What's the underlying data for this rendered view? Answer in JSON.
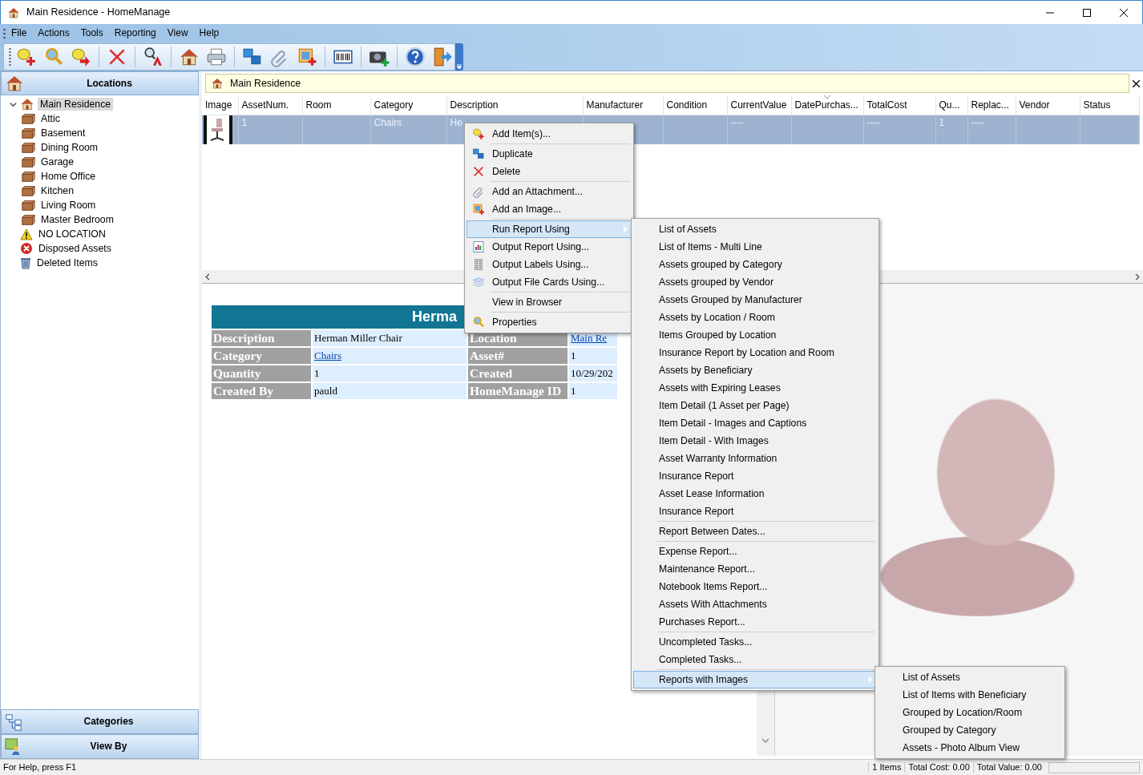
{
  "window": {
    "title": "Main Residence - HomeManage"
  },
  "menu_bar": [
    "File",
    "Actions",
    "Tools",
    "Reporting",
    "View",
    "Help"
  ],
  "sidebar": {
    "title": "Locations",
    "tree": [
      {
        "label": "Main Residence",
        "kind": "residence",
        "selected": true,
        "expanded": true,
        "children": [
          {
            "label": "Attic",
            "kind": "room",
            "selected": false
          },
          {
            "label": "Basement",
            "kind": "room",
            "selected": false
          },
          {
            "label": "Dining Room",
            "kind": "room",
            "selected": false
          },
          {
            "label": "Garage",
            "kind": "room",
            "selected": false
          },
          {
            "label": "Home Office",
            "kind": "room",
            "selected": false
          },
          {
            "label": "Kitchen",
            "kind": "room",
            "selected": false
          },
          {
            "label": "Living Room",
            "kind": "room",
            "selected": false
          },
          {
            "label": "Master Bedroom",
            "kind": "room",
            "selected": false
          }
        ]
      },
      {
        "label": "NO LOCATION",
        "kind": "alert",
        "selected": false
      },
      {
        "label": "Disposed Assets",
        "kind": "disposed",
        "selected": false
      },
      {
        "label": "Deleted Items",
        "kind": "deleted",
        "selected": false
      }
    ],
    "footer_buttons": [
      "Categories",
      "View By"
    ]
  },
  "breadcrumb": "Main Residence",
  "table": {
    "columns": [
      {
        "label": "Image",
        "sorted": false
      },
      {
        "label": "AssetNum.",
        "sorted": false
      },
      {
        "label": "Room",
        "sorted": false
      },
      {
        "label": "Category",
        "sorted": false
      },
      {
        "label": "Description",
        "sorted": false
      },
      {
        "label": "Manufacturer",
        "sorted": false
      },
      {
        "label": "Condition",
        "sorted": false
      },
      {
        "label": "CurrentValue",
        "sorted": false
      },
      {
        "label": "DatePurchas...",
        "sorted": true
      },
      {
        "label": "TotalCost",
        "sorted": false
      },
      {
        "label": "Qu...",
        "sorted": false
      },
      {
        "label": "Replac...",
        "sorted": false
      },
      {
        "label": "Vendor",
        "sorted": false
      },
      {
        "label": "Status",
        "sorted": false
      }
    ],
    "rows": [
      {
        "selected": true,
        "photo": true,
        "cells": [
          null,
          "1",
          null,
          "Chairs",
          "He",
          null,
          null,
          "----",
          null,
          "----",
          "1",
          "----",
          null,
          null
        ]
      }
    ]
  },
  "details": {
    "title": "Herma",
    "fields": [
      {
        "label": "Description",
        "value": "Herman Miller Chair",
        "link": false
      },
      {
        "label": "Location",
        "value": "Main Re",
        "link": true
      },
      {
        "label": "Category",
        "value": "Chairs",
        "link": true
      },
      {
        "label": "Asset#",
        "value": "1",
        "link": false
      },
      {
        "label": "Quantity",
        "value": "1",
        "link": false
      },
      {
        "label": "Created",
        "value": "10/29/202",
        "link": false
      },
      {
        "label": "Created By",
        "value": "pauld",
        "link": false
      },
      {
        "label": "HomeManage ID",
        "value": "1",
        "link": false
      }
    ]
  },
  "context_menu": {
    "groups": [
      [
        {
          "label": "Add Item(s)...",
          "selected": false,
          "submenu": false
        }
      ],
      [
        {
          "label": "Duplicate",
          "selected": false,
          "submenu": false
        },
        {
          "label": "Delete",
          "selected": false,
          "submenu": false
        }
      ],
      [
        {
          "label": "Add an Attachment...",
          "selected": false,
          "submenu": false
        },
        {
          "label": "Add an Image...",
          "selected": false,
          "submenu": false
        }
      ],
      [
        {
          "label": "Run Report Using",
          "selected": true,
          "submenu": true
        },
        {
          "label": "Output Report Using...",
          "selected": false,
          "submenu": false
        },
        {
          "label": "Output Labels Using...",
          "selected": false,
          "submenu": false
        },
        {
          "label": "Output File Cards Using...",
          "selected": false,
          "submenu": false
        }
      ],
      [
        {
          "label": "View in Browser",
          "selected": false,
          "submenu": false
        }
      ],
      [
        {
          "label": "Properties",
          "selected": false,
          "submenu": false
        }
      ]
    ]
  },
  "report_submenu": {
    "groups": [
      [
        {
          "label": "List of Assets",
          "selected": false,
          "submenu": false
        },
        {
          "label": "List of Items - Multi Line",
          "selected": false,
          "submenu": false
        },
        {
          "label": "Assets grouped by Category",
          "selected": false,
          "submenu": false
        },
        {
          "label": "Assets grouped by Vendor",
          "selected": false,
          "submenu": false
        },
        {
          "label": "Assets Grouped by Manufacturer",
          "selected": false,
          "submenu": false
        },
        {
          "label": "Assets by Location / Room",
          "selected": false,
          "submenu": false
        },
        {
          "label": "Items Grouped by Location",
          "selected": false,
          "submenu": false
        },
        {
          "label": "Insurance Report by Location and Room",
          "selected": false,
          "submenu": false
        },
        {
          "label": "Assets by Beneficiary",
          "selected": false,
          "submenu": false
        },
        {
          "label": "Assets with Expiring Leases",
          "selected": false,
          "submenu": false
        },
        {
          "label": "Item Detail (1 Asset per Page)",
          "selected": false,
          "submenu": false
        },
        {
          "label": "Item Detail - Images and Captions",
          "selected": false,
          "submenu": false
        },
        {
          "label": "Item Detail - With Images",
          "selected": false,
          "submenu": false
        },
        {
          "label": "Asset Warranty Information",
          "selected": false,
          "submenu": false
        },
        {
          "label": "Insurance Report",
          "selected": false,
          "submenu": false
        },
        {
          "label": "Asset Lease Information",
          "selected": false,
          "submenu": false
        },
        {
          "label": "Insurance Report",
          "selected": false,
          "submenu": false
        }
      ],
      [
        {
          "label": "Report Between Dates...",
          "selected": false,
          "submenu": false
        }
      ],
      [
        {
          "label": "Expense Report...",
          "selected": false,
          "submenu": false
        },
        {
          "label": "Maintenance Report...",
          "selected": false,
          "submenu": false
        },
        {
          "label": "Notebook Items Report...",
          "selected": false,
          "submenu": false
        },
        {
          "label": "Assets With Attachments",
          "selected": false,
          "submenu": false
        },
        {
          "label": "Purchases Report...",
          "selected": false,
          "submenu": false
        }
      ],
      [
        {
          "label": "Uncompleted Tasks...",
          "selected": false,
          "submenu": false
        },
        {
          "label": "Completed Tasks...",
          "selected": false,
          "submenu": false
        }
      ],
      [
        {
          "label": "Reports with Images",
          "selected": true,
          "submenu": true
        }
      ]
    ]
  },
  "images_submenu": {
    "groups": [
      [
        {
          "label": "List of Assets",
          "selected": false,
          "submenu": false
        },
        {
          "label": "List of Items with Beneficiary",
          "selected": false,
          "submenu": false
        },
        {
          "label": "Grouped by Location/Room",
          "selected": false,
          "submenu": false
        },
        {
          "label": "Grouped by Category",
          "selected": false,
          "submenu": false
        },
        {
          "label": "Assets - Photo Album View",
          "selected": false,
          "submenu": false
        }
      ]
    ]
  },
  "status_bar": {
    "help": "For Help, press F1",
    "items": "1 Items",
    "total_cost": "Total Cost: 0.00",
    "total_value": "Total Value: 0.00",
    "progress": {
      "level": 0
    }
  }
}
